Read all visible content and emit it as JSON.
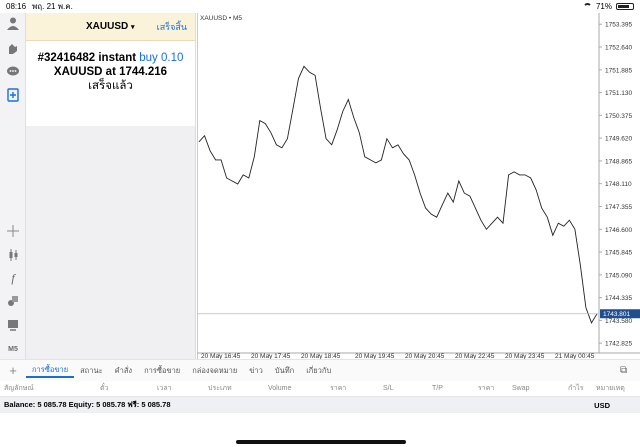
{
  "status": {
    "time": "08:16",
    "date": "พฤ. 21 พ.ค.",
    "battery": "71%"
  },
  "toolbar_icons": [
    "user-icon",
    "hand-icon",
    "chat-icon",
    "document-plus-icon",
    "crosshair-icon",
    "candle-icon",
    "function-icon",
    "object-icon",
    "template-icon",
    "timeframe-icon"
  ],
  "toolbar": {
    "timeframe_label": "M5"
  },
  "order": {
    "symbol": "XAUUSD",
    "dropdown_glyph": "▾",
    "done_label": "เสร็จสิ้น",
    "line1_ticket": "#32416482 instant",
    "line1_buy": "buy 0.10",
    "line2_symbol": "XAUUSD at",
    "line2_price": "1744.216",
    "line3_status": "เสร็จแล้ว"
  },
  "chart": {
    "label": "XAUUSD • M5",
    "current_price": "1743.801",
    "price_ticks": [
      "1753.395",
      "1752.640",
      "1751.885",
      "1751.130",
      "1750.375",
      "1749.620",
      "1748.865",
      "1748.110",
      "1747.355",
      "1746.600",
      "1745.845",
      "1745.090",
      "1744.335",
      "1743.580",
      "1742.825"
    ],
    "time_ticks": [
      "20 May 16:45",
      "20 May 17:45",
      "20 May 18:45",
      "20 May 19:45",
      "20 May 20:45",
      "20 May 22:45",
      "20 May 23:45",
      "21 May 00:45"
    ]
  },
  "chart_data": {
    "type": "line",
    "title": "XAUUSD • M5",
    "ylim": [
      1742.5,
      1753.7
    ],
    "x_labels": [
      "20 May 16:45",
      "20 May 17:45",
      "20 May 18:45",
      "20 May 19:45",
      "20 May 20:45",
      "20 May 22:45",
      "20 May 23:45",
      "21 May 00:45"
    ],
    "series": [
      {
        "values": [
          1749.5,
          1749.7,
          1749.2,
          1748.9,
          1748.9,
          1748.3,
          1748.2,
          1748.1,
          1748.4,
          1748.3,
          1749.0,
          1750.2,
          1750.1,
          1749.8,
          1749.4,
          1749.3,
          1749.6,
          1750.6,
          1751.6,
          1752.0,
          1751.8,
          1751.7,
          1750.6,
          1749.6,
          1749.4,
          1749.9,
          1750.5,
          1750.9,
          1750.3,
          1749.8,
          1749.0,
          1748.9,
          1748.8,
          1748.9,
          1749.6,
          1749.3,
          1749.4,
          1749.1,
          1748.9,
          1748.4,
          1747.8,
          1747.3,
          1747.1,
          1747.0,
          1747.4,
          1747.8,
          1747.5,
          1748.2,
          1747.8,
          1747.7,
          1747.3,
          1746.9,
          1746.6,
          1746.8,
          1747.0,
          1746.8,
          1748.4,
          1748.5,
          1748.4,
          1748.4,
          1748.3,
          1747.9,
          1747.3,
          1747.0,
          1746.4,
          1746.8,
          1746.7,
          1746.9,
          1746.6,
          1745.4,
          1744.0,
          1743.5,
          1743.8
        ],
        "current": 1743.801
      }
    ]
  },
  "tabs": [
    "การซื้อขาย",
    "สถานะ",
    "คำสั่ง",
    "การซื้อขาย",
    "กล่องจดหมาย",
    "ข่าว",
    "บันทึก",
    "เกี่ยวกับ"
  ],
  "columns": [
    "สัญลักษณ์",
    "ตั๋ว",
    "เวลา",
    "ประเภท",
    "Volume",
    "ราคา",
    "S/L",
    "T/P",
    "ราคา",
    "Swap",
    "กำไร",
    "หมายเหตุ"
  ],
  "balance": {
    "text": "Balance: 5 085.78  Equity: 5 085.78  ฟรี: 5 085.78",
    "currency": "USD"
  }
}
